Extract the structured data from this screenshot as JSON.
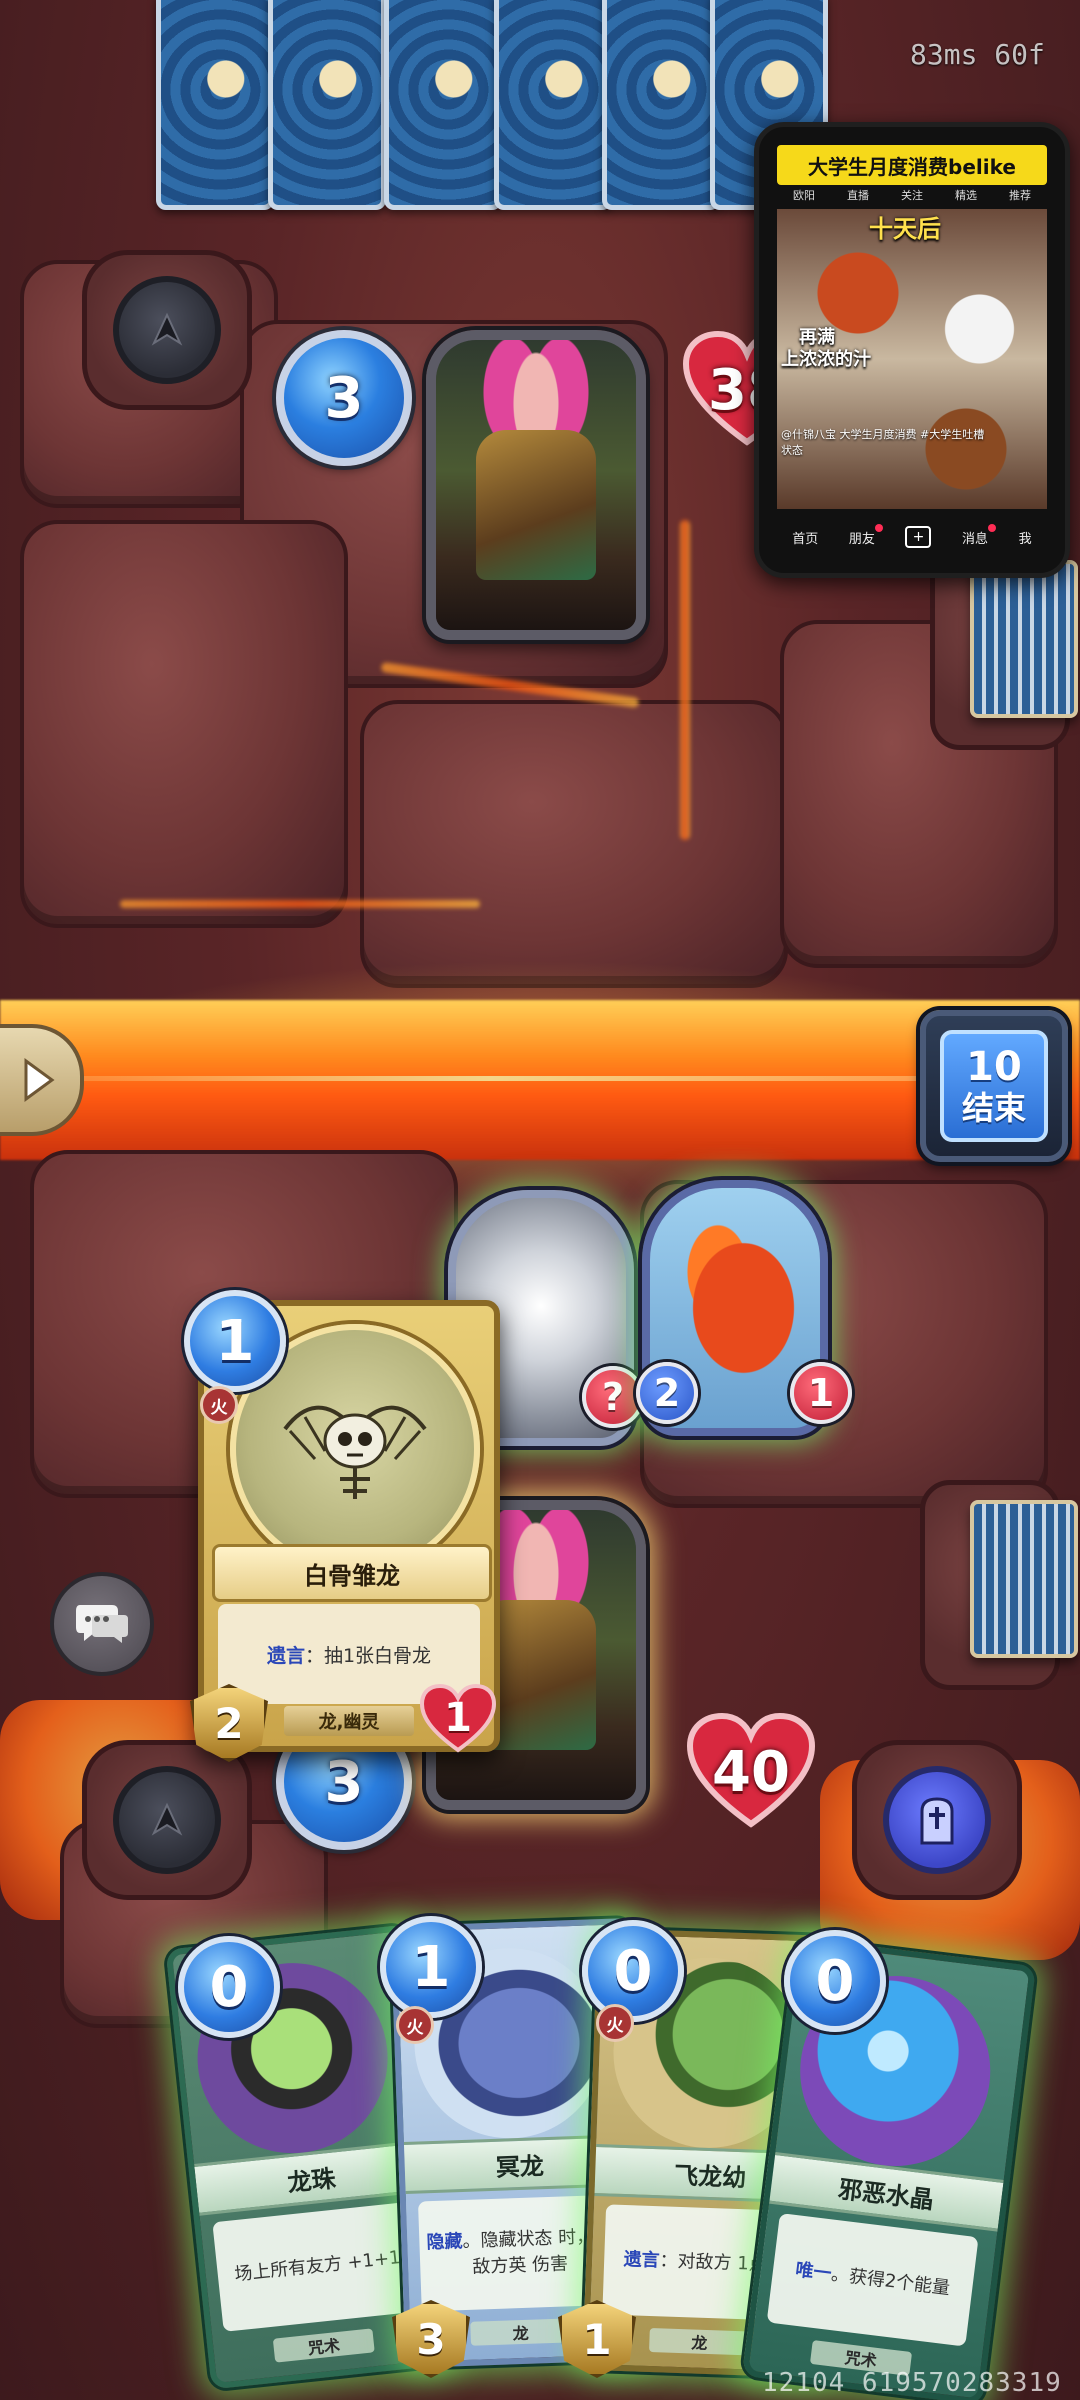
{
  "status": {
    "fps": "83ms 60f",
    "id": "12104 619570283319"
  },
  "opponent": {
    "mana": "3",
    "health": "38"
  },
  "player": {
    "mana": "3",
    "health": "40"
  },
  "end_turn": {
    "turn": "10",
    "label": "结束"
  },
  "board": {
    "minions": [
      {
        "name": "smoke-minion",
        "attack": "",
        "health": "?"
      },
      {
        "name": "red-dragon-minion",
        "attack": "2",
        "health": "1"
      }
    ]
  },
  "zoom_card": {
    "cost": "1",
    "element": "火",
    "name": "白骨雏龙",
    "keyword": "遗言",
    "text": "：抽1张白骨龙",
    "tribe": "龙,幽灵",
    "attack": "2",
    "health": "1"
  },
  "hand": [
    {
      "cost": "0",
      "element": "",
      "name": "龙珠",
      "desc": "场上所有友方 +1+1",
      "type": "咒术"
    },
    {
      "cost": "1",
      "element": "火",
      "name": "冥龙",
      "desc_keyword": "隐藏",
      "desc": "。隐藏状态 时，对敌方英 伤害",
      "type": "龙",
      "attack": "3"
    },
    {
      "cost": "0",
      "element": "火",
      "name": "飞龙幼",
      "desc_keyword": "遗言",
      "desc": "：对敌方 1点伤",
      "type": "龙",
      "attack": "1"
    },
    {
      "cost": "0",
      "element": "",
      "name": "邪恶水晶",
      "desc_keyword": "唯一",
      "desc": "。获得2个能量",
      "type": "咒术"
    }
  ],
  "pip": {
    "title": "大学生月度消费belike",
    "tabs": [
      "欧阳",
      "直播",
      "关注",
      "精选",
      "推荐"
    ],
    "overlay_top": "十天后",
    "overlay_left_1": "再满",
    "overlay_left_2": "上浓浓的汁",
    "caption": "@什锦八宝 大学生月度消费 #大学生吐槽状态",
    "nav": [
      "首页",
      "朋友",
      "+",
      "消息",
      "我"
    ]
  },
  "colors": {
    "lava": "#ff6b1a",
    "mana_blue": "#2b7fe0",
    "health_red": "#d8283f",
    "glow_green": "#78ff6e"
  }
}
